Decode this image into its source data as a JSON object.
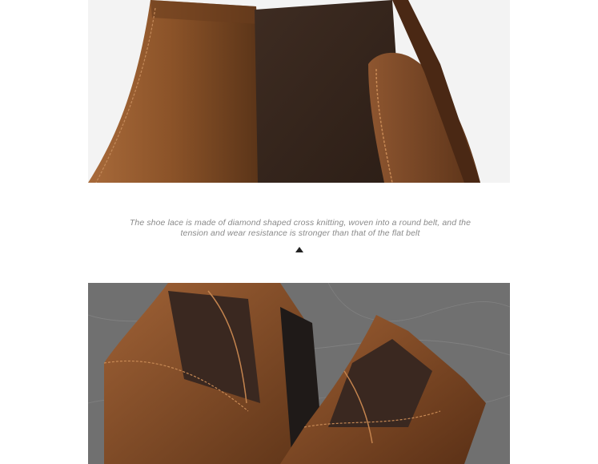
{
  "caption": {
    "line1": "The shoe lace is made of diamond shaped cross knitting, woven into a round belt, and the",
    "line2": "tension and wear resistance is stronger than that of the flat belt"
  },
  "colors": {
    "leather": "#7a4a26",
    "leather_dark": "#4a2a14",
    "elastic": "#3d2a20",
    "marble": "#6f6f6f",
    "caption_text": "#8a8a8a"
  }
}
